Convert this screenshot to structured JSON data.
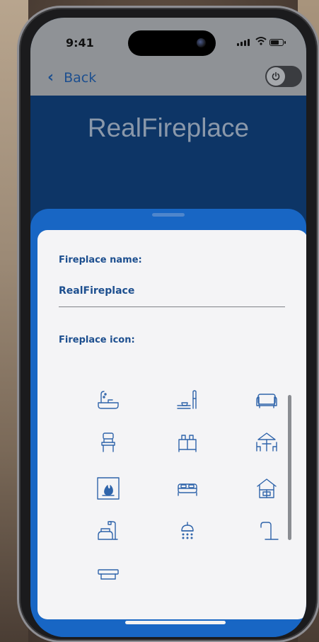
{
  "status_bar": {
    "time": "9:41"
  },
  "nav": {
    "back_label": "Back",
    "back_chevron": "‹"
  },
  "title": "RealFireplace",
  "form": {
    "name_label": "Fireplace name:",
    "name_value": "RealFireplace",
    "icon_label": "Fireplace icon:"
  },
  "icons": [
    "bathtub-icon",
    "kitchen-counter-icon",
    "sofa-icon",
    "chair-icon",
    "dresser-icon",
    "patio-table-icon",
    "fireplace-icon",
    "bed-icon",
    "house-icon",
    "armchair-lamp-icon",
    "shower-icon",
    "faucet-icon",
    "table-icon"
  ],
  "colors": {
    "accent": "#1866c4",
    "header_bg": "#0d3566",
    "label_text": "#1d4f8f",
    "icon_stroke": "#2f64aa",
    "card_bg": "#f4f4f6"
  }
}
